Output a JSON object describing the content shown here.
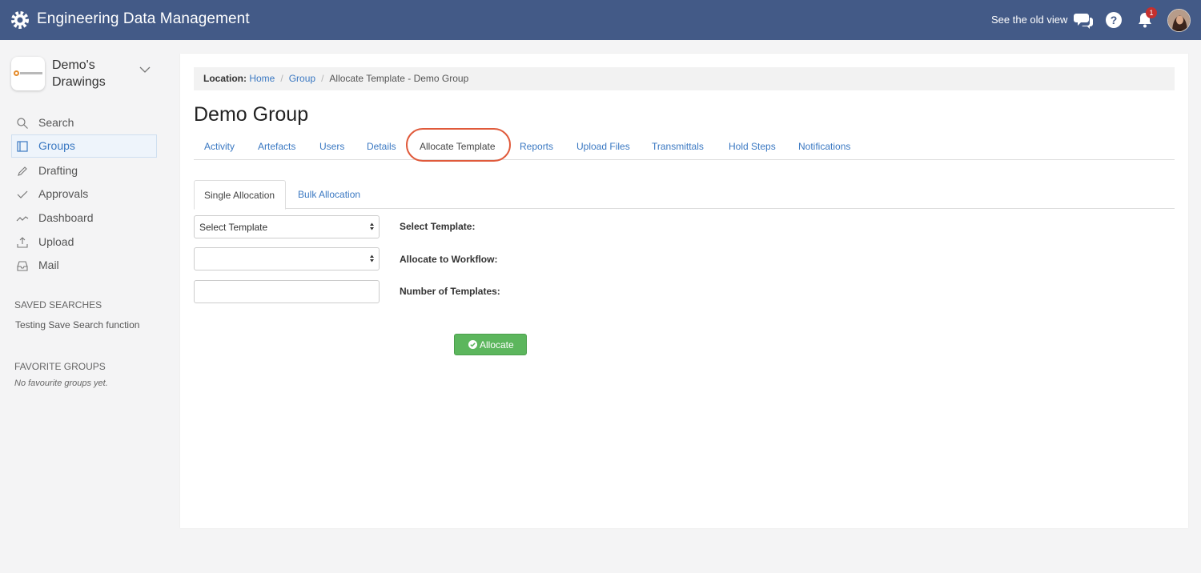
{
  "header": {
    "app_title": "Engineering Data Management",
    "old_view_link": "See the old view",
    "notification_count": "1",
    "icons": [
      "gear-logo-icon",
      "chat-icon",
      "help-icon",
      "bell-icon"
    ],
    "color": "#435a87"
  },
  "sidebar": {
    "workspace_name": "Demo's Drawings",
    "nav": [
      {
        "label": "Search",
        "icon": "search-icon"
      },
      {
        "label": "Groups",
        "icon": "book-icon",
        "active": true
      },
      {
        "label": "Drafting",
        "icon": "pencil-icon"
      },
      {
        "label": "Approvals",
        "icon": "checkmark-icon"
      },
      {
        "label": "Dashboard",
        "icon": "line-chart-icon"
      },
      {
        "label": "Upload",
        "icon": "upload-icon"
      },
      {
        "label": "Mail",
        "icon": "inbox-icon"
      }
    ],
    "saved_searches_heading": "SAVED SEARCHES",
    "saved_searches": [
      "Testing Save Search function"
    ],
    "favorite_groups_heading": "FAVORITE GROUPS",
    "favorite_groups_empty": "No favourite groups yet."
  },
  "breadcrumb": {
    "prefix": "Location:",
    "items": [
      "Home",
      "Group",
      "Allocate Template - Demo Group"
    ]
  },
  "page": {
    "title": "Demo Group",
    "tabs": [
      "Activity",
      "Artefacts",
      "Users",
      "Details",
      "Allocate Template",
      "Reports",
      "Upload Files",
      "Transmittals",
      "Hold Steps",
      "Notifications"
    ],
    "active_tab": "Allocate Template",
    "subtabs": [
      "Single Allocation",
      "Bulk Allocation"
    ],
    "active_subtab": "Single Allocation"
  },
  "form": {
    "template_select_value": "Select Template",
    "workflow_select_value": "",
    "number_input_value": "",
    "labels": {
      "template": "Select Template:",
      "workflow": "Allocate to Workflow:",
      "number": "Number of Templates:"
    },
    "submit_label": "Allocate",
    "submit_color": "#5cb65d"
  },
  "accent_color": "#3a78c2",
  "highlight_color": "#e05a3b"
}
